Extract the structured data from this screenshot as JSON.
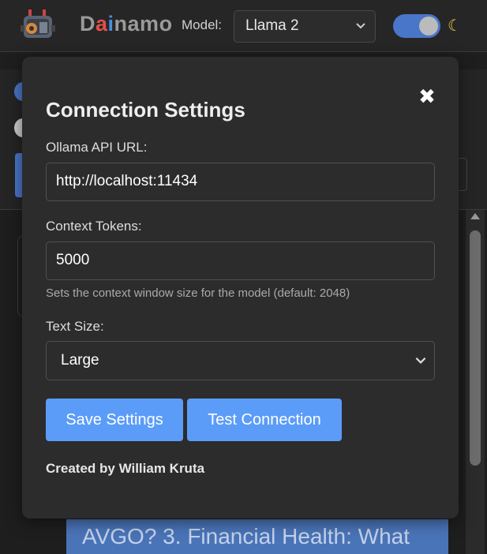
{
  "header": {
    "app_icon": "robot-icon",
    "brand_part1": "Dai",
    "brand_part2": "namo",
    "model_label": "Model:",
    "model_selected": "Llama 2",
    "theme_toggle_on": true,
    "theme_icon": "moon-icon"
  },
  "background": {
    "visible_text": "AVGO? 3. Financial Health: What"
  },
  "modal": {
    "title": "Connection Settings",
    "close_symbol": "✖",
    "api_url_label": "Ollama API URL:",
    "api_url_value": "http://localhost:11434",
    "context_tokens_label": "Context Tokens:",
    "context_tokens_value": "5000",
    "context_hint": "Sets the context window size for the model (default: 2048)",
    "text_size_label": "Text Size:",
    "text_size_selected": "Large",
    "save_button": "Save Settings",
    "test_button": "Test Connection",
    "credit": "Created by William Kruta"
  },
  "colors": {
    "accent_blue": "#5b9cf8",
    "toggle_blue": "#4a76c9",
    "modal_bg": "#2c2c2c",
    "page_bg": "#1e1e1e"
  }
}
